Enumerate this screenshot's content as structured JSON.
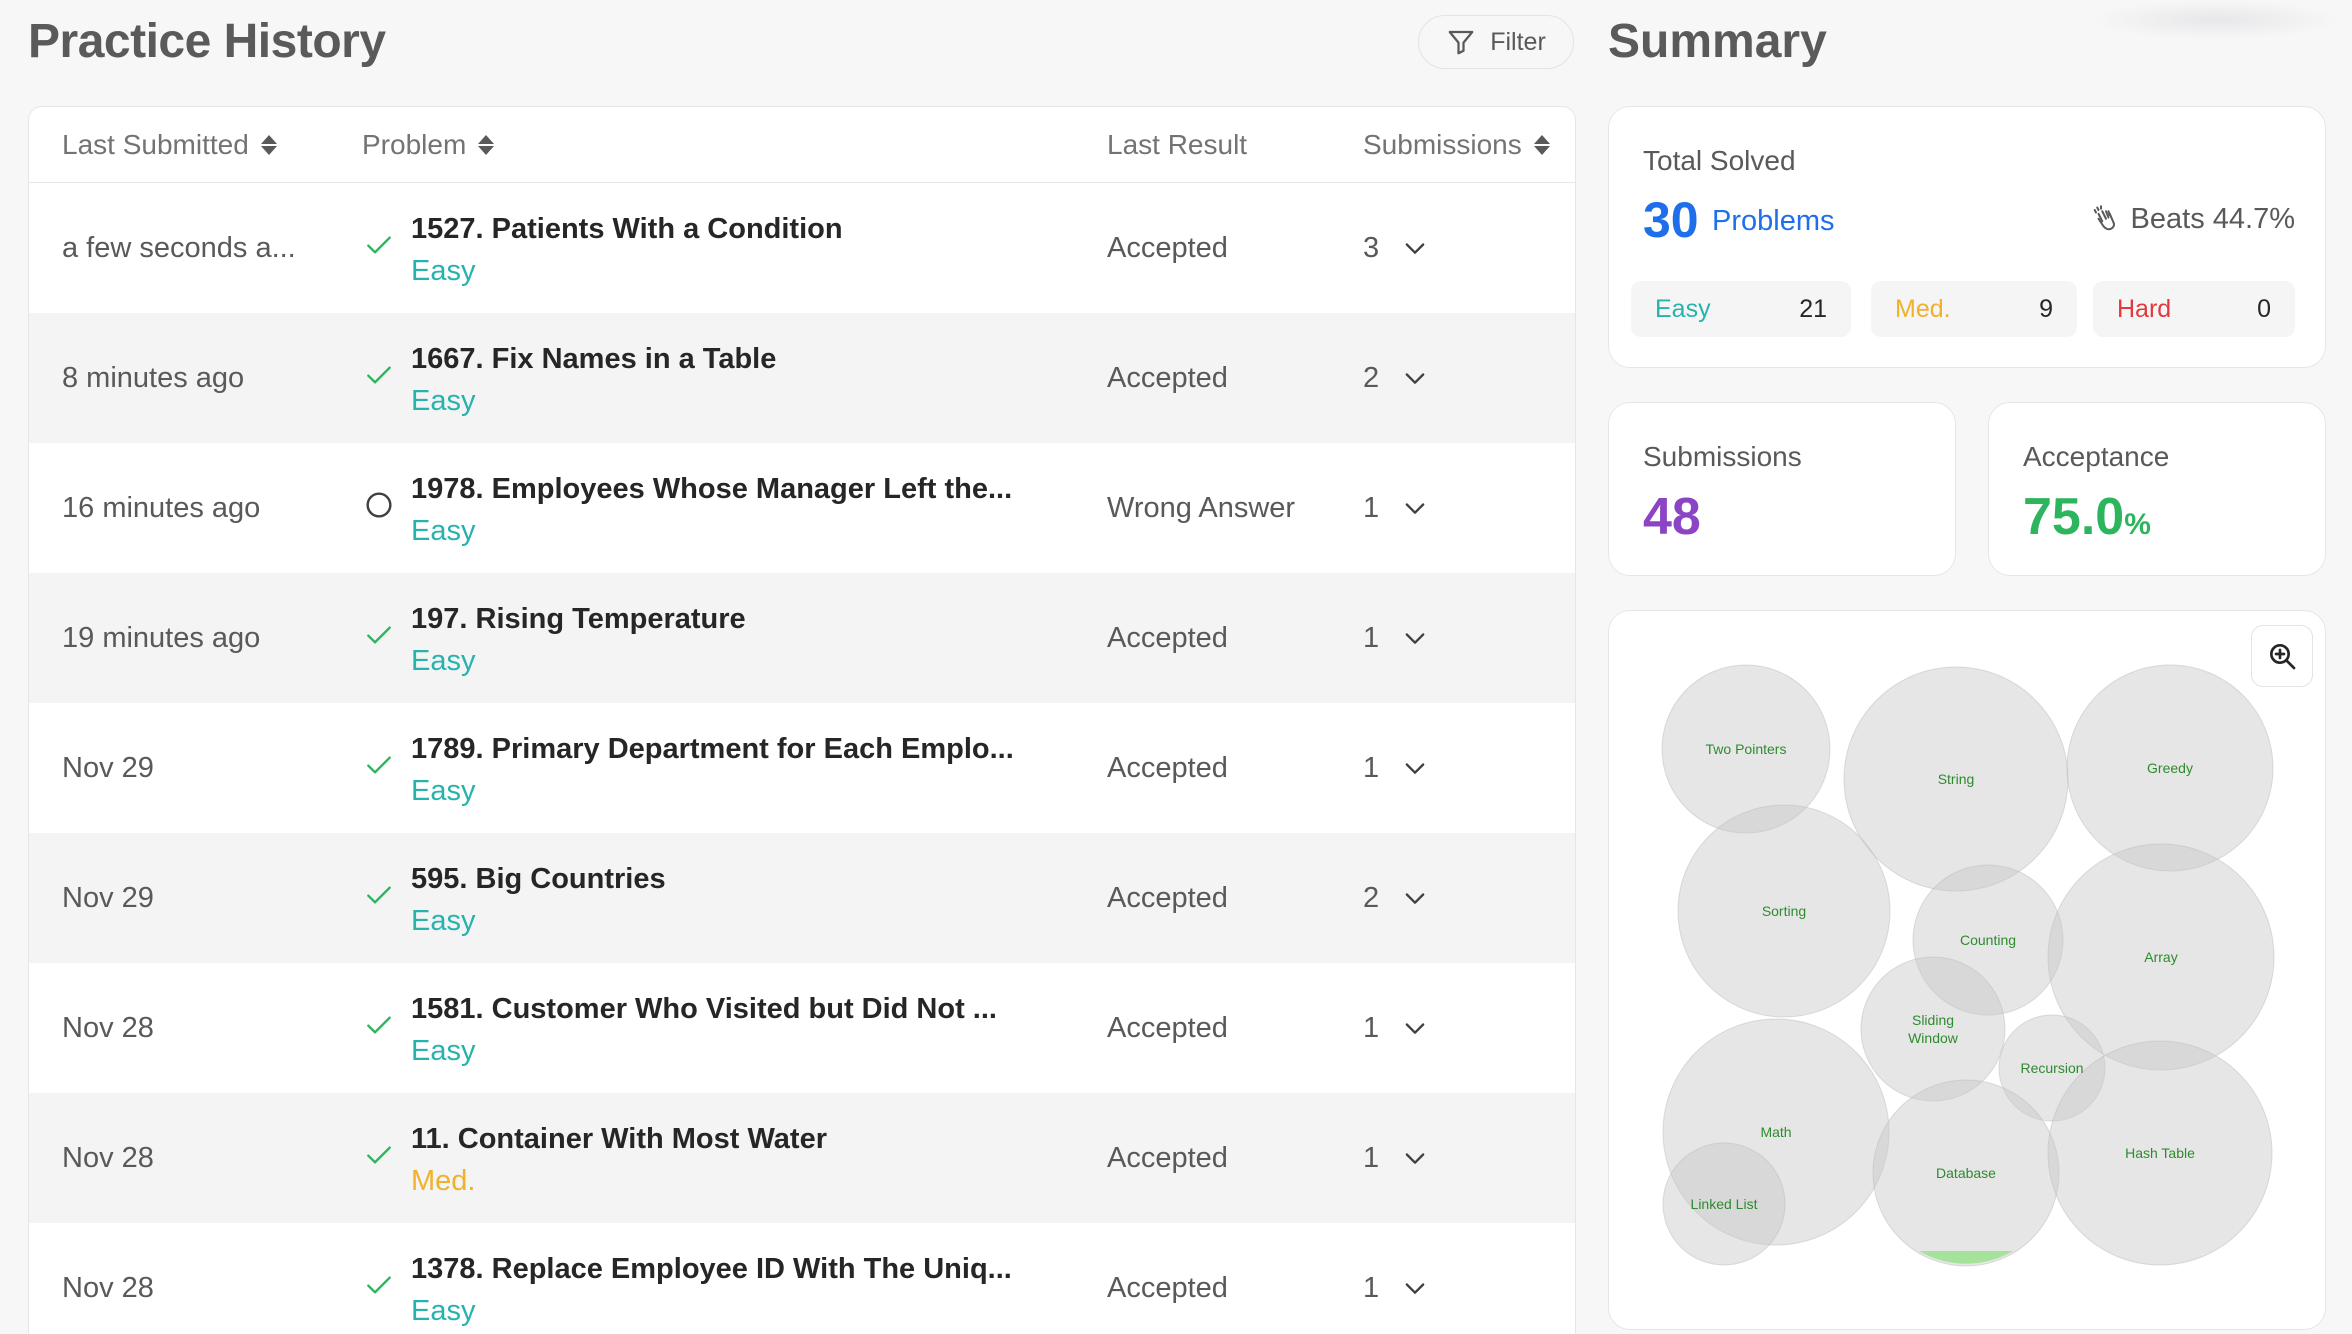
{
  "history": {
    "title": "Practice History",
    "filter_label": "Filter",
    "columns": {
      "last_submitted": "Last Submitted",
      "problem": "Problem",
      "last_result": "Last Result",
      "submissions": "Submissions"
    },
    "rows": [
      {
        "date": "a few seconds a...",
        "title": "1527. Patients With a Condition",
        "difficulty": "Easy",
        "result": "Accepted",
        "submissions": "3",
        "status": "accepted"
      },
      {
        "date": "8 minutes ago",
        "title": "1667. Fix Names in a Table",
        "difficulty": "Easy",
        "result": "Accepted",
        "submissions": "2",
        "status": "accepted"
      },
      {
        "date": "16 minutes ago",
        "title": "1978. Employees Whose Manager Left the...",
        "difficulty": "Easy",
        "result": "Wrong Answer",
        "submissions": "1",
        "status": "attempted"
      },
      {
        "date": "19 minutes ago",
        "title": "197. Rising Temperature",
        "difficulty": "Easy",
        "result": "Accepted",
        "submissions": "1",
        "status": "accepted"
      },
      {
        "date": "Nov 29",
        "title": "1789. Primary Department for Each Emplo...",
        "difficulty": "Easy",
        "result": "Accepted",
        "submissions": "1",
        "status": "accepted"
      },
      {
        "date": "Nov 29",
        "title": "595. Big Countries",
        "difficulty": "Easy",
        "result": "Accepted",
        "submissions": "2",
        "status": "accepted"
      },
      {
        "date": "Nov 28",
        "title": "1581. Customer Who Visited but Did Not ...",
        "difficulty": "Easy",
        "result": "Accepted",
        "submissions": "1",
        "status": "accepted"
      },
      {
        "date": "Nov 28",
        "title": "11. Container With Most Water",
        "difficulty": "Med.",
        "result": "Accepted",
        "submissions": "1",
        "status": "accepted"
      },
      {
        "date": "Nov 28",
        "title": "1378. Replace Employee ID With The Uniq...",
        "difficulty": "Easy",
        "result": "Accepted",
        "submissions": "1",
        "status": "accepted"
      }
    ]
  },
  "summary": {
    "title": "Summary",
    "total_solved_label": "Total Solved",
    "solved_count": "30",
    "solved_unit": "Problems",
    "beats": "Beats 44.7%",
    "difficulty": [
      {
        "label": "Easy",
        "count": "21",
        "color": "#26b3ad"
      },
      {
        "label": "Med.",
        "count": "9",
        "color": "#f0b12b"
      },
      {
        "label": "Hard",
        "count": "0",
        "color": "#e0393e"
      }
    ],
    "submissions_label": "Submissions",
    "submissions_value": "48",
    "acceptance_label": "Acceptance",
    "acceptance_value": "75.0",
    "acceptance_unit": "%"
  },
  "topics": [
    "Two Pointers",
    "String",
    "Greedy",
    "Sorting",
    "Counting",
    "Array",
    "Sliding Window",
    "Recursion",
    "Math",
    "Database",
    "Hash Table",
    "Linked List"
  ],
  "colors": {
    "accent": "#1f6feb",
    "easy": "#26b3ad",
    "medium": "#f0b12b",
    "hard": "#e0393e",
    "accepted_check": "#2db55d",
    "submissions": "#8b44c4",
    "acceptance": "#2db55d"
  }
}
